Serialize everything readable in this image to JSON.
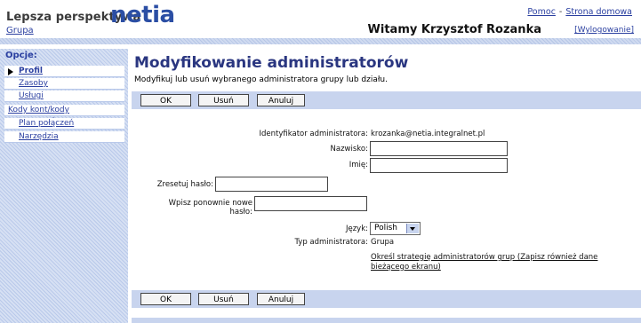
{
  "header": {
    "brand_text": "Lepsza perspektywa",
    "logo_text": "netia",
    "group_link": "Grupa",
    "help_link": "Pomoc",
    "separator": "-",
    "home_link": "Strona domowa",
    "welcome": "Witamy Krzysztof Rozanka",
    "logout": "[Wylogowanie]"
  },
  "sidebar": {
    "options_label": "Opcje:",
    "items": [
      {
        "label": "Profil",
        "active": true
      },
      {
        "label": "Zasoby"
      },
      {
        "label": "Usługi"
      },
      {
        "label": "Kody kont/kody autoryzacyjne"
      },
      {
        "label": "Plan połączeń"
      },
      {
        "label": "Narzędzia"
      }
    ]
  },
  "main": {
    "title": "Modyfikowanie administratorów",
    "description": "Modyfikuj lub usuń wybranego administratora grupy lub działu.",
    "buttons": {
      "ok": "OK",
      "delete": "Usuń",
      "cancel": "Anuluj"
    },
    "form": {
      "admin_id_label": "Identyfikator administratora:",
      "admin_id_value": "krozanka@netia.integralnet.pl",
      "lastname_label": "Nazwisko:",
      "lastname_value": "",
      "firstname_label": "Imię:",
      "firstname_value": "",
      "reset_password_label": "Zresetuj hasło:",
      "reset_password_value": "",
      "confirm_password_label": "Wpisz ponownie nowe hasło:",
      "confirm_password_value": "",
      "language_label": "Język:",
      "language_value": "Polish",
      "admin_type_label": "Typ administratora:",
      "admin_type_value": "Grupa",
      "strategy_link": "Określ strategię administratorów grup (Zapisz również dane bieżącego ekranu)"
    }
  }
}
